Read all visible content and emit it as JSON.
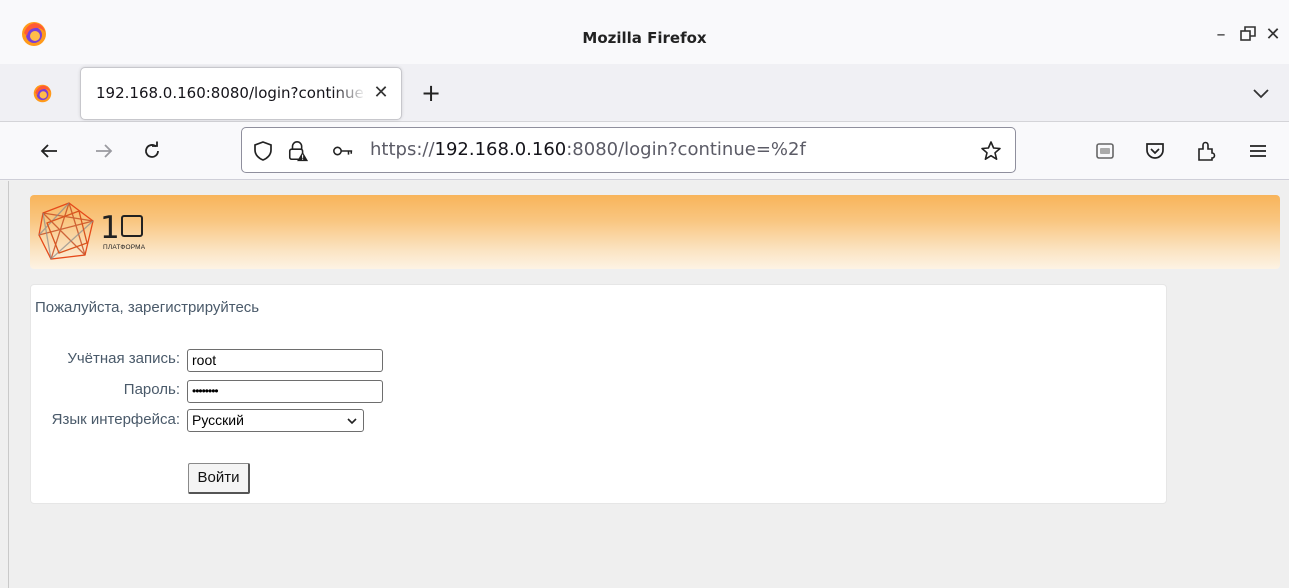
{
  "window": {
    "title": "Mozilla Firefox",
    "controls": {
      "minimize": "–",
      "restore": "🗗",
      "close": "✕"
    }
  },
  "tabs": [
    {
      "title": "192.168.0.160:8080/login?continue=%2f",
      "close": "✕",
      "active": true
    }
  ],
  "tabbar": {
    "new_tab": "+"
  },
  "toolbar": {
    "url_scheme": "https://",
    "url_host": "192.168.0.160",
    "url_rest": ":8080/login?continue=%2f"
  },
  "page": {
    "brand_number": "10",
    "brand_subtitle": "ПЛАТФОРМА",
    "prompt": "Пожалуйста, зарегистрируйтесь",
    "form": {
      "account_label": "Учётная запись:",
      "account_value": "root",
      "password_label": "Пароль:",
      "password_value": "••••••••",
      "language_label": "Язык интерфейса:",
      "language_selected": "Русский",
      "submit_label": "Войти"
    }
  },
  "colors": {
    "header_gradient_top": "#f8b45a",
    "header_gradient_bottom": "#fdf3e4",
    "label_text": "#4a5a6a"
  }
}
